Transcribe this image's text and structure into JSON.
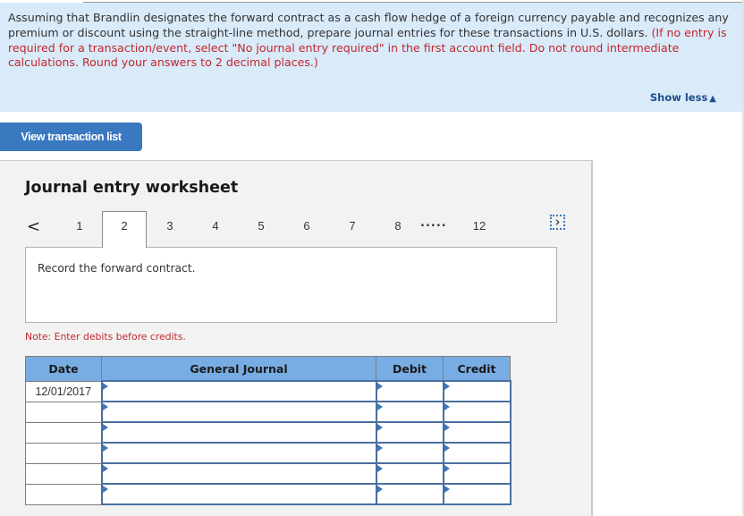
{
  "instructions": {
    "text_main": "Assuming that Brandlin designates the forward contract as a cash flow hedge of a foreign currency payable and recognizes any premium or discount using the straight-line method, prepare journal entries for these transactions in U.S. dollars.",
    "text_note": "(If no entry is required for a transaction/event, select \"No journal entry required\" in the first account field. Do not round intermediate calculations. Round your answers to 2 decimal places.)",
    "show_less_label": "Show less",
    "show_less_icon": "triangle-up-icon"
  },
  "view_transaction_list_label": "View transaction list",
  "worksheet": {
    "title": "Journal entry worksheet",
    "pager": {
      "prev_icon": "chevron-left-icon",
      "pages": [
        "1",
        "2",
        "3",
        "4",
        "5",
        "6",
        "7",
        "8"
      ],
      "active_page": "2",
      "ellipsis": ".....",
      "last_page": "12",
      "next_icon": "chevron-right-icon"
    },
    "description": "Record the forward contract.",
    "note": "Note: Enter debits before credits.",
    "table": {
      "headers": [
        "Date",
        "General Journal",
        "Debit",
        "Credit"
      ],
      "rows": [
        {
          "date": "12/01/2017",
          "account": "",
          "debit": "",
          "credit": ""
        },
        {
          "date": "",
          "account": "",
          "debit": "",
          "credit": ""
        },
        {
          "date": "",
          "account": "",
          "debit": "",
          "credit": ""
        },
        {
          "date": "",
          "account": "",
          "debit": "",
          "credit": ""
        },
        {
          "date": "",
          "account": "",
          "debit": "",
          "credit": ""
        },
        {
          "date": "",
          "account": "",
          "debit": "",
          "credit": ""
        }
      ]
    }
  },
  "colors": {
    "instruction_bg": "#d9eaf8",
    "warning_red": "#c2272d",
    "button_blue": "#3a78bf",
    "table_header_blue": "#78ade3",
    "input_border": "#4a6f9e"
  }
}
